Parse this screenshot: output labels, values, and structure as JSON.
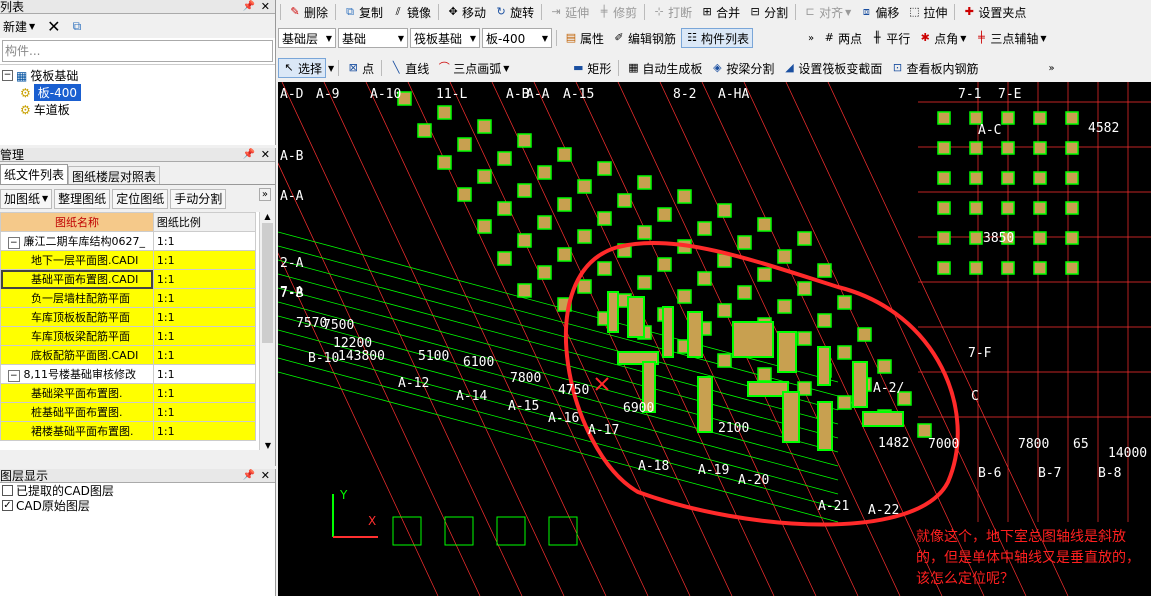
{
  "component_list": {
    "title": "列表",
    "new_label": "新建",
    "search_placeholder": "构件...",
    "tree_root": "筏板基础",
    "tree_items": [
      "板-400",
      "车道板"
    ]
  },
  "drawing_management": {
    "title": "管理",
    "tabs": [
      "纸文件列表",
      "图纸楼层对照表"
    ],
    "buttons": [
      "加图纸",
      "整理图纸",
      "定位图纸",
      "手动分割"
    ],
    "col_name": "图纸名称",
    "col_scale": "图纸比例",
    "rows": [
      {
        "name": "廉江二期车库结构0627_",
        "scale": "1:1",
        "group": true
      },
      {
        "name": "地下一层平面图.CADI",
        "scale": "1:1"
      },
      {
        "name": "基础平面布置图.CADI",
        "scale": "1:1"
      },
      {
        "name": "负一层墙柱配筋平面",
        "scale": "1:1"
      },
      {
        "name": "车库顶板板配筋平面",
        "scale": "1:1"
      },
      {
        "name": "车库顶板梁配筋平面",
        "scale": "1:1"
      },
      {
        "name": "底板配筋平面图.CADI",
        "scale": "1:1"
      },
      {
        "name": "8,11号楼基础审核修改",
        "scale": "1:1",
        "group": true
      },
      {
        "name": "基础梁平面布置图.",
        "scale": "1:1"
      },
      {
        "name": "桩基础平面布置图.",
        "scale": "1:1"
      },
      {
        "name": "裙楼基础平面布置图.",
        "scale": "1:1"
      }
    ]
  },
  "layer_display": {
    "title": "图层显示",
    "items": [
      "已提取的CAD图层",
      "CAD原始图层"
    ]
  },
  "toolbar": {
    "row1": [
      "删除",
      "复制",
      "镜像",
      "移动",
      "旋转",
      "延伸",
      "修剪",
      "打断",
      "合并",
      "分割",
      "对齐",
      "偏移",
      "拉伸",
      "设置夹点"
    ],
    "floor": "基础层",
    "category": "基础",
    "type": "筏板基础",
    "component": "板-400",
    "row2": [
      "属性",
      "编辑钢筋",
      "构件列表",
      "两点",
      "平行",
      "点角",
      "三点辅轴"
    ],
    "row3": [
      "选择",
      "点",
      "直线",
      "三点画弧",
      "矩形",
      "自动生成板",
      "按梁分割",
      "设置筏板变截面",
      "查看板内钢筋"
    ]
  },
  "canvas": {
    "axis_labels": [
      "A-D",
      "A-9",
      "A-10",
      "11-L",
      "A-B",
      "A-A",
      "A-15",
      "8-2",
      "A-HA",
      "7-1",
      "7-E",
      "A-C",
      "A-B",
      "A-A",
      "2-A",
      "7-B",
      "7-A",
      "7-F",
      "C",
      "B-10",
      "A-12",
      "A-14",
      "A-15",
      "A-16",
      "A-17",
      "A-18",
      "A-19",
      "A-20",
      "A-21",
      "A-22",
      "B-6",
      "B-7",
      "B-8",
      "A-2/"
    ],
    "dims": [
      "12200",
      "143800",
      "5100",
      "6100",
      "7800",
      "4750",
      "6900",
      "2100",
      "1482",
      "7000",
      "7800",
      "65",
      "14000",
      "3850",
      "4582",
      "7570",
      "7500"
    ],
    "annotation": "就像这个，地下室总图轴线是斜放的，但是单体中轴线又是垂直放的，该怎么定位呢？",
    "ucs_y": "Y",
    "ucs_x": "X",
    "colors": {
      "circle": "#ff2a2a",
      "grid": "#00ff00",
      "axis": "#ff3030",
      "note": "#ff2020"
    }
  }
}
